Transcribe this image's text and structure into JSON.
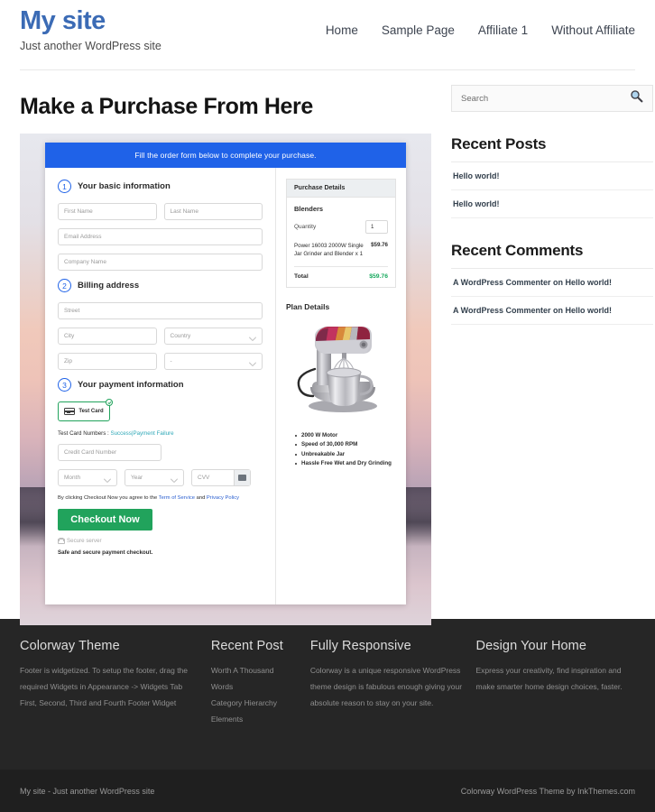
{
  "header": {
    "site_title": "My site",
    "tagline": "Just another WordPress site",
    "nav": [
      {
        "label": "Home"
      },
      {
        "label": "Sample Page"
      },
      {
        "label": "Affiliate 1"
      },
      {
        "label": "Without Affiliate"
      }
    ]
  },
  "main": {
    "page_title": "Make a Purchase From Here",
    "order_form": {
      "banner": "Fill the order form below to complete your purchase.",
      "steps": {
        "basic": {
          "num": "1",
          "label": "Your basic information"
        },
        "billing": {
          "num": "2",
          "label": "Billing address"
        },
        "payment": {
          "num": "3",
          "label": "Your payment information"
        }
      },
      "fields": {
        "first_name": "First Name",
        "last_name": "Last Name",
        "email": "Email Address",
        "company": "Company Name",
        "street": "Street",
        "city": "City",
        "country": "Country",
        "zip": "Zip",
        "state": "-",
        "credit_card": "Credit Card Number",
        "month": "Month",
        "year": "Year",
        "cvv": "CVV"
      },
      "test_card": {
        "button_label": "Test Card",
        "numbers_label": "Test Card Numbers :",
        "success": "Success",
        "separator": "|",
        "failure": "Payment Failure"
      },
      "terms": {
        "prefix": "By clicking Checkout Now you agree to the",
        "tos": "Term of Service",
        "and": "and",
        "privacy": "Privacy Policy"
      },
      "checkout_label": "Checkout Now",
      "secure_server": "Secure server",
      "safe_note": "Safe and secure payment checkout."
    },
    "purchase_details": {
      "heading": "Purchase Details",
      "product": "Blenders",
      "quantity_label": "Quantity",
      "quantity_value": "1",
      "item_name": "Power 16003 2000W Single Jar Grinder and Blender x 1",
      "item_price": "$59.76",
      "total_label": "Total",
      "total_value": "$59.76",
      "total_color": "#17a95e"
    },
    "plan_details": {
      "heading": "Plan Details",
      "features": [
        "2000 W Motor",
        "Speed of 30,000 RPM",
        "Unbreakable Jar",
        "Hassle Free Wet and Dry Grinding"
      ]
    }
  },
  "sidebar": {
    "search": {
      "placeholder": "Search",
      "icon": "search-icon"
    },
    "recent_posts": {
      "title": "Recent Posts",
      "items": [
        "Hello world!",
        "Hello world!"
      ]
    },
    "recent_comments": {
      "title": "Recent Comments",
      "items": [
        "A WordPress Commenter on Hello world!",
        "A WordPress Commenter on Hello world!"
      ]
    }
  },
  "footer": {
    "columns": [
      {
        "title": "Colorway Theme",
        "text": "Footer is widgetized. To setup the footer, drag the required Widgets in Appearance -> Widgets Tab First, Second, Third and Fourth Footer Widget"
      },
      {
        "title": "Recent Post",
        "items": [
          "Worth A Thousand Words",
          "Category Hierarchy",
          "Elements"
        ]
      },
      {
        "title": "Fully Responsive",
        "text": "Colorway is a unique responsive WordPress theme design is fabulous enough giving your absolute reason to stay on your site."
      },
      {
        "title": "Design Your Home",
        "text": "Express your creativity, find inspiration and make smarter home design choices, faster."
      }
    ],
    "bar": {
      "left": "My site - Just another WordPress site",
      "right": "Colorway WordPress Theme by InkThemes.com"
    }
  },
  "colors": {
    "brand_blue": "#3b6bb5",
    "banner_blue": "#1f62e8",
    "accent_green": "#21a35c",
    "link_teal": "#2fa8b8",
    "footer_dark": "#262626"
  }
}
